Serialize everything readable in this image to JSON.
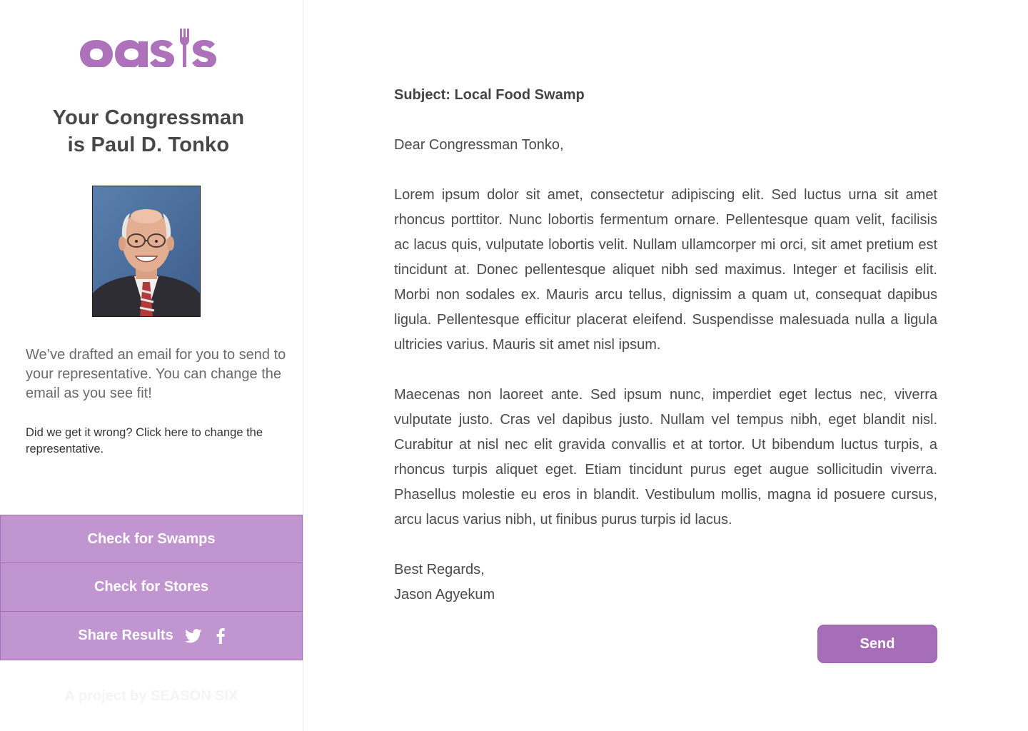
{
  "brand": {
    "logo_text": "oasis",
    "color": "#ad72b9"
  },
  "sidebar": {
    "rep_title_line1": "Your Congressman",
    "rep_title_line2": "is Paul D. Tonko",
    "photo_icon": "congressman-portrait",
    "drafted_text": "We’ve drafted an email for you to send to your representative. You can change the email as you see fit!",
    "wrong_link": "Did we get it wrong? Click here to change the representative.",
    "nav": {
      "check_swamps": "Check for Swamps",
      "check_stores": "Check for Stores",
      "share_results": "Share Results",
      "share_icons": [
        "twitter-icon",
        "facebook-icon"
      ]
    },
    "footer_credit": "A project by SEASON SIX",
    "button_color": "#c195cf"
  },
  "email": {
    "subject": "Subject: Local Food Swamp",
    "greeting": "Dear Congressman Tonko,",
    "paragraph1": "Lorem ipsum dolor sit amet, consectetur adipiscing elit. Sed luctus urna sit amet rhoncus porttitor. Nunc lobortis fermentum ornare. Pellentesque quam velit, facilisis ac lacus quis, vulputate lobortis velit. Nullam ullamcorper mi orci, sit amet pretium est tincidunt at. Donec pellentesque aliquet nibh sed maximus. Integer et facilisis elit. Morbi non sodales ex. Mauris arcu tellus, dignissim a quam ut, consequat dapibus ligula. Pellentesque efficitur placerat eleifend. Suspendisse malesuada nulla a ligula ultricies varius. Mauris sit amet nisl ipsum.",
    "paragraph2": "Maecenas non laoreet ante. Sed ipsum nunc, imperdiet eget lectus nec, viverra vulputate justo. Cras vel dapibus justo. Nullam vel tempus nibh, eget blandit nisl. Curabitur at nisl nec elit gravida convallis et at tortor. Ut bibendum luctus turpis, a rhoncus turpis aliquet  eget. Etiam tincidunt purus eget augue sollicitudin viverra. Phasellus molestie eu eros in blandit. Vestibulum mollis, magna id posuere cursus, arcu lacus varius nibh, ut finibus purus turpis id lacus.",
    "signoff": "Best Regards,",
    "sender": "Jason Agyekum",
    "send_label": "Send",
    "send_color": "#a66eb6"
  }
}
